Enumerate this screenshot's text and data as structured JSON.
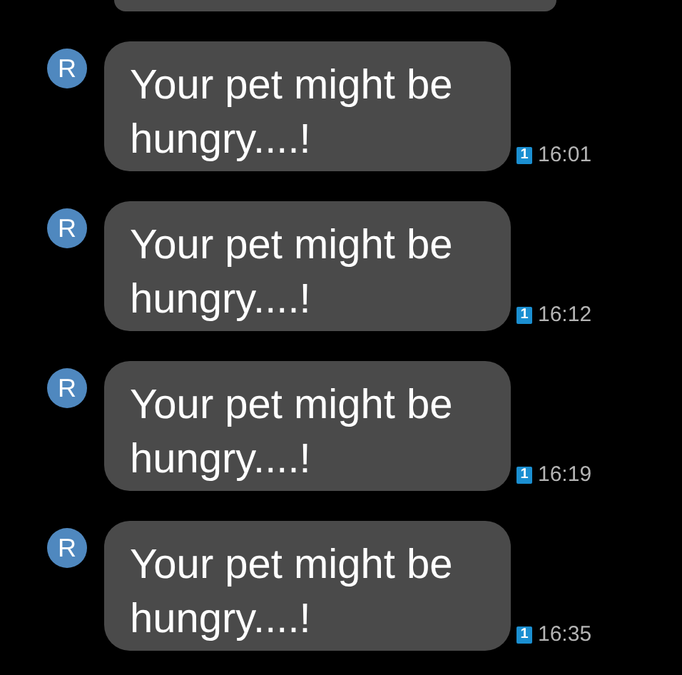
{
  "messages": [
    {
      "avatar": "R",
      "text": "Your pet might be hungry....!",
      "sim": "1",
      "time": "16:01"
    },
    {
      "avatar": "R",
      "text": "Your pet might be hungry....!",
      "sim": "1",
      "time": "16:12"
    },
    {
      "avatar": "R",
      "text": "Your pet might be hungry....!",
      "sim": "1",
      "time": "16:19"
    },
    {
      "avatar": "R",
      "text": "Your pet might be hungry....!",
      "sim": "1",
      "time": "16:35"
    }
  ]
}
